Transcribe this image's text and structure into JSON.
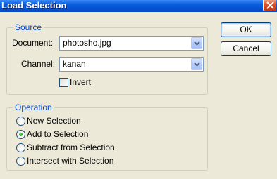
{
  "window": {
    "title": "Load Selection"
  },
  "source": {
    "legend": "Source",
    "document_label": "Document:",
    "document_value": "photosho.jpg",
    "channel_label": "Channel:",
    "channel_value": "kanan",
    "invert_label": "Invert",
    "invert_checked": false
  },
  "operation": {
    "legend": "Operation",
    "options": [
      {
        "label": "New Selection",
        "selected": false
      },
      {
        "label": "Add to Selection",
        "selected": true
      },
      {
        "label": "Subtract from Selection",
        "selected": false
      },
      {
        "label": "Intersect with Selection",
        "selected": false
      }
    ]
  },
  "buttons": {
    "ok_label": "OK",
    "cancel_label": "Cancel"
  },
  "icons": {
    "close": "close-icon",
    "dropdown": "chevron-down-icon"
  }
}
